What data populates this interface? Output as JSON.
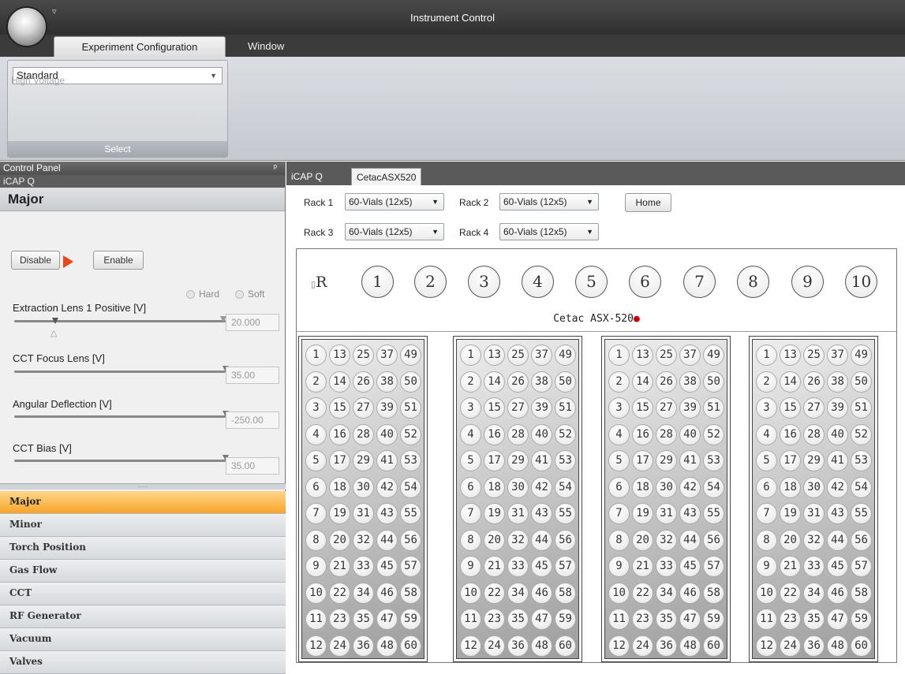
{
  "window": {
    "title": "Instrument Control",
    "qat_glyph": "▿"
  },
  "ribbon": {
    "tabs": [
      "Experiment Configuration",
      "Window"
    ],
    "combo_value": "Standard",
    "group_label": "Select"
  },
  "control_panel": {
    "title": "Control Panel",
    "pin": "ᵖ",
    "device": "iCAP Q",
    "section": "Major",
    "high_voltage_label": "High Voltage",
    "disable_label": "Disable",
    "enable_label": "Enable",
    "hard_label": "Hard",
    "soft_label": "Soft",
    "params": [
      {
        "label": "Extraction Lens 1 Positive [V]",
        "value": "20.000"
      },
      {
        "label": "CCT Focus Lens [V]",
        "value": "35.00"
      },
      {
        "label": "Angular Deflection [V]",
        "value": "-250.00"
      },
      {
        "label": "CCT Bias [V]",
        "value": "35.00"
      }
    ],
    "nav": [
      "Major",
      "Minor",
      "Torch Position",
      "Gas Flow",
      "CCT",
      "RF Generator",
      "Vacuum",
      "Valves"
    ]
  },
  "device_tabs": [
    "iCAP Q",
    "CetacASX520"
  ],
  "racks": [
    {
      "label": "Rack 1",
      "value": "60-Vials (12x5)"
    },
    {
      "label": "Rack 2",
      "value": "60-Vials (12x5)"
    },
    {
      "label": "Rack 3",
      "value": "60-Vials (12x5)"
    },
    {
      "label": "Rack 4",
      "value": "60-Vials (12x5)"
    }
  ],
  "home_label": "Home",
  "autosampler": {
    "rinse_label": "R",
    "rinse_prefix": "▯",
    "standards": [
      "1",
      "2",
      "3",
      "4",
      "5",
      "6",
      "7",
      "8",
      "9",
      "10"
    ],
    "name": "Cetac ASX-520",
    "status_dot": "●",
    "status_color": "#cc0000"
  },
  "colors": {
    "accent": "#f6a52a",
    "play": "#e8481a"
  }
}
